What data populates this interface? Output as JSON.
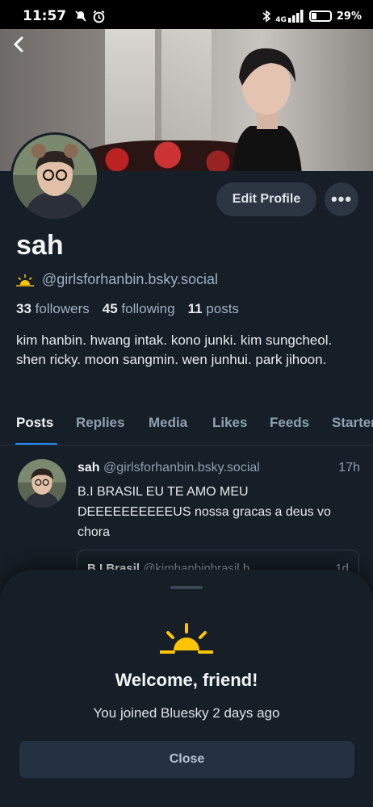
{
  "status_bar": {
    "time": "11:57",
    "network": "4G",
    "battery": "29%",
    "battery_level": 0.29
  },
  "profile": {
    "display_name": "sah",
    "handle": "@girlsforhanbin.bsky.social",
    "followers_count": "33",
    "followers_label": "followers",
    "following_count": "45",
    "following_label": "following",
    "posts_count": "11",
    "posts_label": "posts",
    "bio": "kim hanbin. hwang intak. kono junki. kim sungcheol. shen ricky. moon sangmin. wen junhui. park jihoon.",
    "edit_label": "Edit Profile",
    "more_label": "•••"
  },
  "tabs": [
    {
      "label": "Posts",
      "active": true
    },
    {
      "label": "Replies"
    },
    {
      "label": "Media"
    },
    {
      "label": "Likes"
    },
    {
      "label": "Feeds"
    },
    {
      "label": "Starter Packs"
    }
  ],
  "post": {
    "author": "sah",
    "handle": "@girlsforhanbin.bsky.social",
    "time": "17h",
    "text": "B.I BRASIL EU TE AMO MEU DEEEEEEEEEEUS nossa gracas a deus vo chora",
    "quote_author": "B.I Brasil",
    "quote_handle": "@kimhanbinbrasil.b...",
    "quote_time": "1d"
  },
  "sheet": {
    "title": "Welcome, friend!",
    "subtitle": "You joined Bluesky 2 days ago",
    "close_label": "Close",
    "icon": "sunrise-icon"
  },
  "colors": {
    "accent": "#208bfe",
    "sun": "#ffc404",
    "background": "#161e27"
  }
}
